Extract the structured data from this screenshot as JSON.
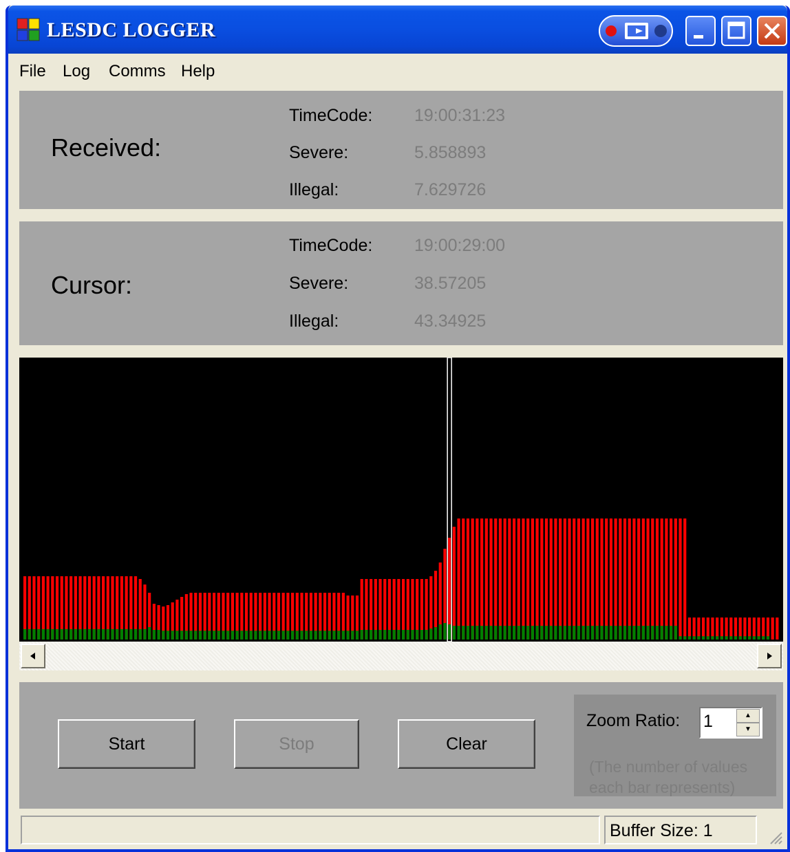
{
  "window": {
    "title": "LESDC LOGGER"
  },
  "menu": {
    "items": [
      "File",
      "Log",
      "Comms",
      "Help"
    ]
  },
  "received": {
    "title": "Received:",
    "timecode_label": "TimeCode:",
    "timecode": "19:00:31:23",
    "severe_label": "Severe:",
    "severe": "5.858893",
    "illegal_label": "Illegal:",
    "illegal": "7.629726"
  },
  "cursor": {
    "title": "Cursor:",
    "timecode_label": "TimeCode:",
    "timecode": "19:00:29:00",
    "severe_label": "Severe:",
    "severe": "38.57205",
    "illegal_label": "Illegal:",
    "illegal": "43.34925"
  },
  "controls": {
    "start": "Start",
    "stop": "Stop",
    "clear": "Clear",
    "zoom_label": "Zoom Ratio:",
    "zoom_value": "1",
    "zoom_hint": "(The number of values each bar represents)"
  },
  "status": {
    "buffer": "Buffer Size: 1"
  },
  "colors": {
    "illegal": "#ff0000",
    "severe": "#007f00",
    "cursor": "#ffffff",
    "panel": "#a5a5a5"
  },
  "chart_data": {
    "type": "bar",
    "cursor_index": 92,
    "max": 100,
    "series": [
      {
        "values": [
          23.0,
          23.0,
          23.0,
          23.0,
          23.0,
          23.0,
          23.0,
          23.0,
          23.0,
          23.0,
          23.0,
          23.0,
          23.0,
          23.0,
          23.0,
          23.0,
          23.0,
          23.0,
          23.0,
          23.0,
          23.0,
          23.0,
          23.0,
          23.0,
          23.0,
          22.0,
          20.0,
          17.0,
          13.0,
          12.5,
          12.0,
          12.5,
          13.5,
          14.5,
          15.5,
          16.5,
          17.0,
          17.0,
          17.0,
          17.0,
          17.0,
          17.0,
          17.0,
          17.0,
          17.0,
          17.0,
          17.0,
          17.0,
          17.0,
          17.0,
          17.0,
          17.0,
          17.0,
          17.0,
          17.0,
          17.0,
          17.0,
          17.0,
          17.0,
          17.0,
          17.0,
          17.0,
          17.0,
          17.0,
          17.0,
          17.0,
          17.0,
          17.0,
          17.0,
          17.0,
          16.0,
          16.0,
          16.0,
          22.0,
          22.0,
          22.0,
          22.0,
          22.0,
          22.0,
          22.0,
          22.0,
          22.0,
          22.0,
          22.0,
          22.0,
          22.0,
          22.0,
          22.0,
          23.0,
          25.0,
          28.0,
          33.0,
          37.0,
          41.0,
          44.0,
          44.0,
          44.0,
          44.0,
          44.0,
          44.0,
          44.0,
          44.0,
          44.0,
          44.0,
          44.0,
          44.0,
          44.0,
          44.0,
          44.0,
          44.0,
          44.0,
          44.0,
          44.0,
          44.0,
          44.0,
          44.0,
          44.0,
          44.0,
          44.0,
          44.0,
          44.0,
          44.0,
          44.0,
          44.0,
          44.0,
          44.0,
          44.0,
          44.0,
          44.0,
          44.0,
          44.0,
          44.0,
          44.0,
          44.0,
          44.0,
          44.0,
          44.0,
          44.0,
          44.0,
          44.0,
          44.0,
          44.0,
          44.0,
          44.0,
          8.0,
          8.0,
          8.0,
          8.0,
          8.0,
          8.0,
          8.0,
          8.0,
          8.0,
          8.0,
          8.0,
          8.0,
          8.0,
          8.0,
          8.0,
          8.0,
          8.0,
          8.0,
          8.0,
          8.0
        ]
      },
      {
        "values": [
          3.8,
          3.8,
          3.8,
          3.8,
          3.8,
          3.8,
          3.8,
          3.8,
          3.8,
          3.8,
          3.8,
          3.8,
          3.8,
          3.8,
          3.8,
          3.8,
          3.8,
          3.8,
          3.8,
          3.8,
          3.8,
          3.8,
          3.8,
          3.8,
          3.8,
          3.8,
          3.8,
          4.5,
          3.5,
          3.5,
          3.2,
          3.2,
          3.2,
          3.2,
          3.2,
          3.2,
          3.2,
          3.2,
          3.2,
          3.2,
          3.2,
          3.2,
          3.2,
          3.2,
          3.2,
          3.2,
          3.2,
          3.2,
          3.2,
          3.2,
          3.2,
          3.2,
          3.2,
          3.2,
          3.2,
          3.2,
          3.2,
          3.2,
          3.2,
          3.2,
          3.2,
          3.2,
          3.2,
          3.2,
          3.2,
          3.2,
          3.2,
          3.2,
          3.2,
          3.2,
          3.2,
          3.2,
          3.2,
          3.5,
          3.5,
          3.5,
          3.5,
          3.5,
          3.5,
          3.5,
          3.5,
          3.5,
          3.5,
          3.5,
          3.5,
          3.5,
          3.5,
          3.5,
          4.0,
          4.5,
          5.5,
          6.0,
          5.5,
          5.0,
          5.0,
          5.0,
          5.0,
          5.0,
          5.0,
          5.0,
          5.0,
          5.0,
          5.0,
          5.0,
          5.0,
          5.0,
          5.0,
          5.0,
          5.0,
          5.0,
          5.0,
          5.0,
          5.0,
          5.0,
          5.0,
          5.0,
          5.0,
          5.0,
          5.0,
          5.0,
          5.0,
          5.0,
          5.0,
          5.0,
          5.0,
          5.0,
          5.0,
          5.0,
          5.0,
          5.0,
          5.0,
          5.0,
          5.0,
          5.0,
          5.0,
          5.0,
          5.0,
          5.0,
          5.0,
          5.0,
          5.0,
          5.0,
          1.2,
          1.2,
          1.2,
          1.2,
          1.2,
          1.2,
          1.2,
          1.2,
          1.2,
          1.2,
          1.2,
          1.2,
          1.2,
          1.2,
          1.2,
          1.2,
          1.2,
          1.2,
          1.2,
          1.2
        ]
      }
    ]
  }
}
